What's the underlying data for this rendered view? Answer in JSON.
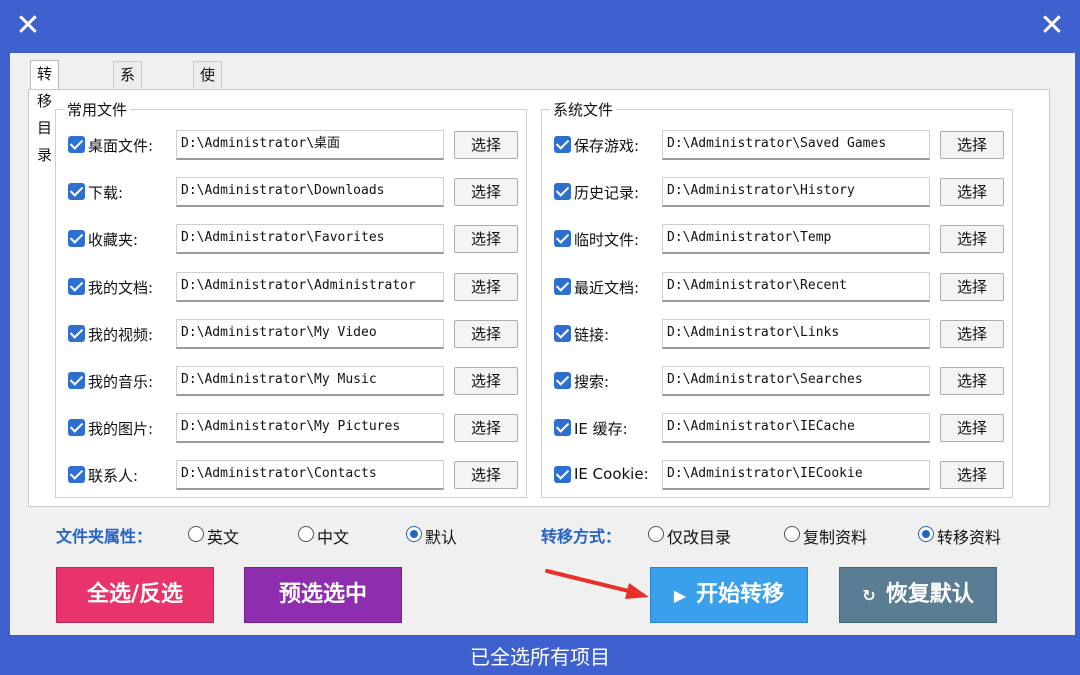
{
  "window": {
    "close_glyph": "✕",
    "status": "已全选所有项目"
  },
  "tabs": [
    "转移目录",
    "系统目录",
    "使用说明"
  ],
  "groups": {
    "common": {
      "title": "常用文件",
      "rows": [
        {
          "label": "桌面文件:",
          "path": "D:\\Administrator\\桌面",
          "checked": true
        },
        {
          "label": "下载:",
          "path": "D:\\Administrator\\Downloads",
          "checked": true
        },
        {
          "label": "收藏夹:",
          "path": "D:\\Administrator\\Favorites",
          "checked": true
        },
        {
          "label": "我的文档:",
          "path": "D:\\Administrator\\Administrator",
          "checked": true
        },
        {
          "label": "我的视频:",
          "path": "D:\\Administrator\\My Video",
          "checked": true
        },
        {
          "label": "我的音乐:",
          "path": "D:\\Administrator\\My Music",
          "checked": true
        },
        {
          "label": "我的图片:",
          "path": "D:\\Administrator\\My Pictures",
          "checked": true
        },
        {
          "label": "联系人:",
          "path": "D:\\Administrator\\Contacts",
          "checked": true
        }
      ]
    },
    "system": {
      "title": "系统文件",
      "rows": [
        {
          "label": "保存游戏:",
          "path": "D:\\Administrator\\Saved Games",
          "checked": true
        },
        {
          "label": "历史记录:",
          "path": "D:\\Administrator\\History",
          "checked": true
        },
        {
          "label": "临时文件:",
          "path": "D:\\Administrator\\Temp",
          "checked": true
        },
        {
          "label": "最近文档:",
          "path": "D:\\Administrator\\Recent",
          "checked": true
        },
        {
          "label": "链接:",
          "path": "D:\\Administrator\\Links",
          "checked": true
        },
        {
          "label": "搜索:",
          "path": "D:\\Administrator\\Searches",
          "checked": true
        },
        {
          "label": "IE 缓存:",
          "path": "D:\\Administrator\\IECache",
          "checked": true
        },
        {
          "label": "IE Cookie:",
          "path": "D:\\Administrator\\IECookie",
          "checked": true
        }
      ]
    },
    "pick_label": "选择"
  },
  "folder_attr": {
    "title": "文件夹属性：",
    "options": [
      "英文",
      "中文",
      "默认"
    ],
    "selected": "默认"
  },
  "transfer_mode": {
    "title": "转移方式：",
    "options": [
      "仅改目录",
      "复制资料",
      "转移资料"
    ],
    "selected": "转移资料"
  },
  "buttons": {
    "select_all": "全选/反选",
    "preselect": "预选选中",
    "start": "开始转移",
    "start_icon": "▶",
    "restore": "恢复默认",
    "restore_icon": "↻"
  },
  "colors": {
    "title_bar": "#3f61d0",
    "select_all": "#e8336b",
    "preselect": "#8e2dae",
    "start": "#3aa0ec",
    "restore": "#5a7d93",
    "annotation_arrow": "#e8302d"
  }
}
